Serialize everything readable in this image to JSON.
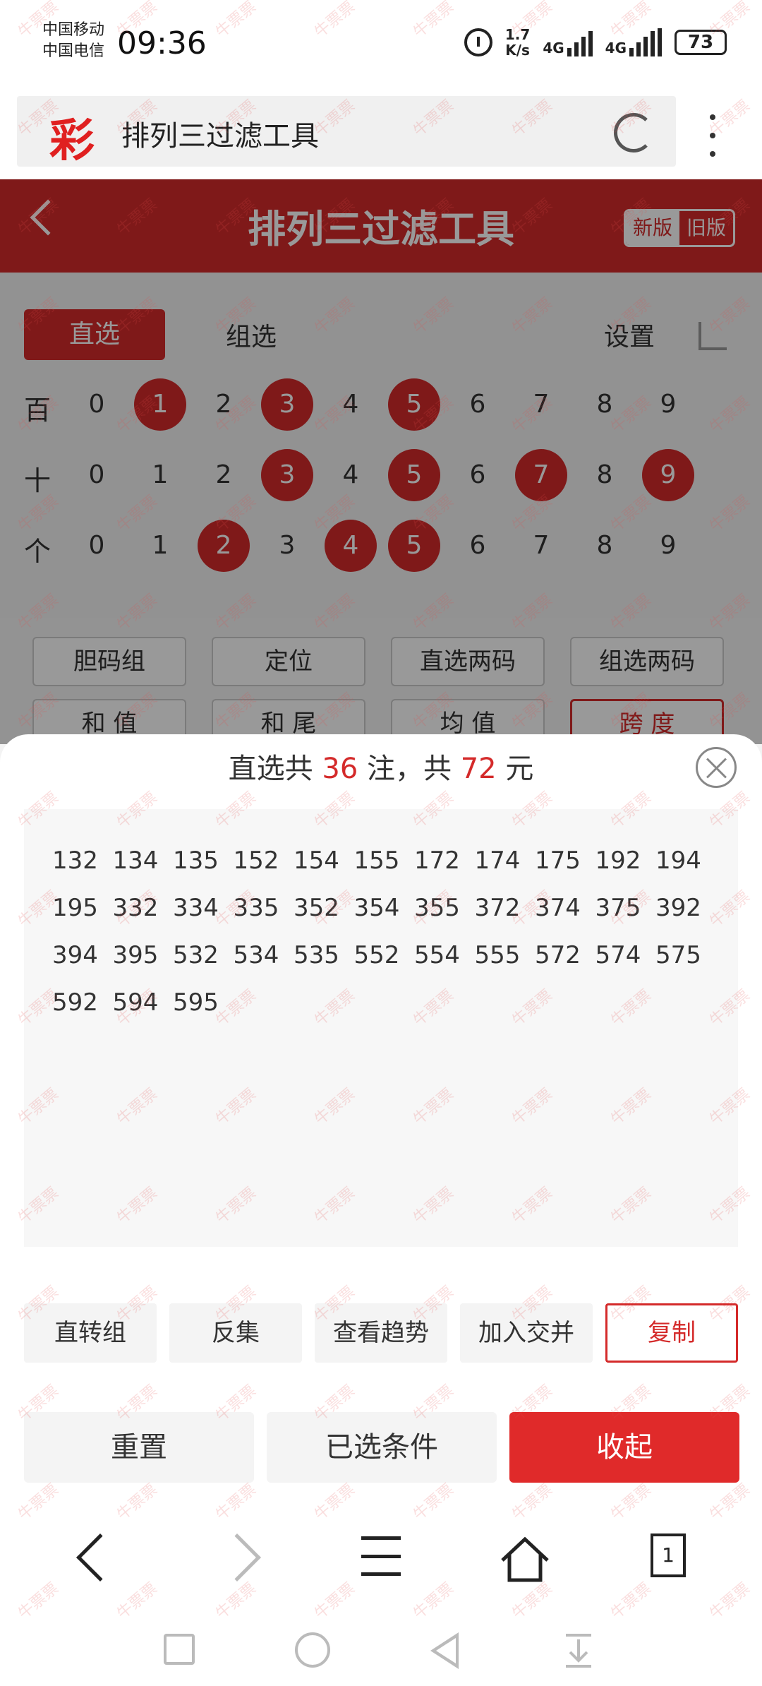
{
  "status_bar": {
    "carrier1": "中国移动",
    "carrier2": "中国电信",
    "time": "09:36",
    "speed_value": "1.7",
    "speed_unit": "K/s",
    "net1": "4G",
    "net2": "4G",
    "battery": "73"
  },
  "browser": {
    "logo": "彩",
    "page_title": "排列三过滤工具"
  },
  "header": {
    "title": "排列三过滤工具",
    "new_version": "新版",
    "old_version": "旧版"
  },
  "tabs": {
    "direct": "直选",
    "group": "组选",
    "settings": "设置"
  },
  "digit_rows": [
    {
      "label": "百",
      "selected": [
        1,
        3,
        5
      ]
    },
    {
      "label": "十",
      "selected": [
        3,
        5,
        7,
        9
      ]
    },
    {
      "label": "个",
      "selected": [
        2,
        4,
        5
      ]
    }
  ],
  "digits": [
    "0",
    "1",
    "2",
    "3",
    "4",
    "5",
    "6",
    "7",
    "8",
    "9"
  ],
  "filter_options": [
    "胆码组",
    "定位",
    "直选两码",
    "组选两码",
    "和 值",
    "和 尾",
    "均 值",
    "跨 度"
  ],
  "sheet": {
    "prefix": "直选共",
    "count": "36",
    "mid": "注，共",
    "amount": "72",
    "suffix": "元"
  },
  "results": [
    "132",
    "134",
    "135",
    "152",
    "154",
    "155",
    "172",
    "174",
    "175",
    "192",
    "194",
    "195",
    "332",
    "334",
    "335",
    "352",
    "354",
    "355",
    "372",
    "374",
    "375",
    "392",
    "394",
    "395",
    "532",
    "534",
    "535",
    "552",
    "554",
    "555",
    "572",
    "574",
    "575",
    "592",
    "594",
    "595"
  ],
  "actions": {
    "to_group": "直转组",
    "inverse": "反集",
    "trend": "查看趋势",
    "intersect": "加入交并",
    "copy": "复制"
  },
  "bottom": {
    "reset": "重置",
    "conditions": "已选条件",
    "collapse": "收起"
  },
  "browser_nav": {
    "tabs_count": "1"
  },
  "watermark": "牛票票",
  "colors": {
    "accent": "#d42a2a",
    "selected_ball": "#d42a2a"
  }
}
